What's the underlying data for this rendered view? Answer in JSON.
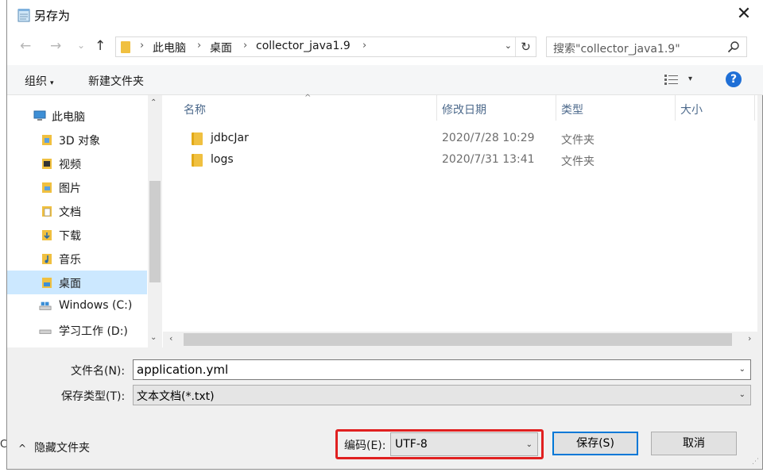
{
  "window": {
    "title": "另存为",
    "close_glyph": "✕"
  },
  "nav": {
    "back_glyph": "←",
    "forward_glyph": "→",
    "recent_glyph": "⌄",
    "up_glyph": "↑",
    "breadcrumbs": [
      "此电脑",
      "桌面",
      "collector_java1.9"
    ],
    "separator": "›",
    "refresh_glyph": "↻",
    "dropdown_glyph": "⌄",
    "search_placeholder": "搜索\"collector_java1.9\"",
    "search_glyph": "⚲"
  },
  "toolbar": {
    "organize_label": "组织",
    "organize_caret": "▾",
    "new_folder_label": "新建文件夹",
    "view_caret": "▾",
    "help_glyph": "?"
  },
  "sidebar": {
    "items": [
      {
        "label": "此电脑",
        "icon": "computer-icon"
      },
      {
        "label": "3D 对象",
        "icon": "cube-folder-icon"
      },
      {
        "label": "视频",
        "icon": "video-folder-icon"
      },
      {
        "label": "图片",
        "icon": "pictures-folder-icon"
      },
      {
        "label": "文档",
        "icon": "documents-folder-icon"
      },
      {
        "label": "下载",
        "icon": "downloads-folder-icon"
      },
      {
        "label": "音乐",
        "icon": "music-folder-icon"
      },
      {
        "label": "桌面",
        "icon": "desktop-folder-icon",
        "selected": true
      },
      {
        "label": "Windows (C:)",
        "icon": "drive-icon"
      },
      {
        "label": "学习工作 (D:)",
        "icon": "drive-icon"
      }
    ],
    "scroll_up": "⌃",
    "scroll_down": "⌄"
  },
  "columns": {
    "name": "名称",
    "modified": "修改日期",
    "type": "类型",
    "size": "大小",
    "sort_caret": "^"
  },
  "files": [
    {
      "name": "jdbcJar",
      "modified": "2020/7/28 10:29",
      "type": "文件夹"
    },
    {
      "name": "logs",
      "modified": "2020/7/31 13:41",
      "type": "文件夹"
    }
  ],
  "hscroll": {
    "left": "‹",
    "right": "›"
  },
  "form": {
    "filename_label": "文件名(N):",
    "filename_value": "application.yml",
    "filetype_label": "保存类型(T):",
    "filetype_value": "文本文档(*.txt)",
    "dropdown_glyph": "⌄"
  },
  "footer": {
    "hide_folders_caret": "^",
    "hide_folders_label": "隐藏文件夹",
    "encoding_label": "编码(E):",
    "encoding_value": "UTF-8",
    "save_label": "保存(S)",
    "cancel_label": "取消",
    "edge_char": "C"
  },
  "colors": {
    "selection": "#cce8ff",
    "accent": "#0078d7",
    "highlight_border": "#e02020",
    "folder": "#f0c040"
  }
}
